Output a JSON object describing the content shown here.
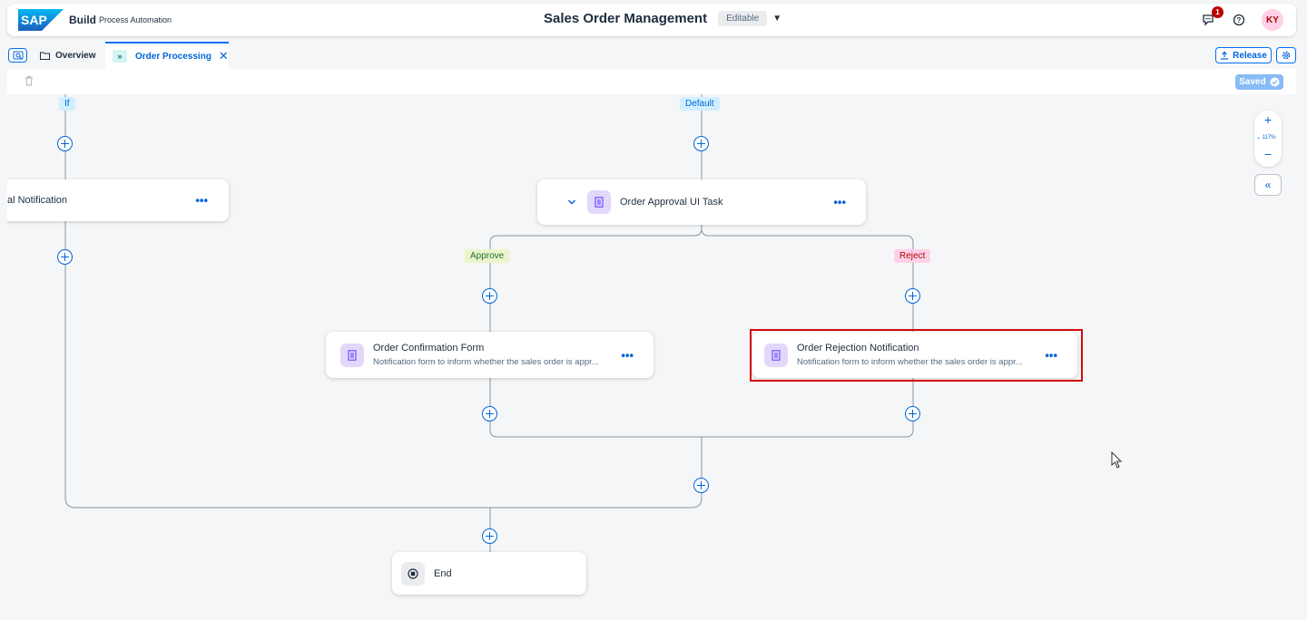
{
  "shell": {
    "brand": "Build",
    "brand_sub": "Process Automation",
    "title": "Sales Order Management",
    "status": "Editable",
    "notification_count": "1",
    "avatar_initials": "KY"
  },
  "tabs": {
    "overview": "Overview",
    "active": "Order Processing",
    "active_icon_text": "»"
  },
  "actions": {
    "release": "Release",
    "saved": "Saved"
  },
  "canvas": {
    "labels": {
      "if": "If",
      "default": "Default",
      "approve": "Approve",
      "reject": "Reject"
    },
    "nodes": {
      "left_partial": {
        "title": "al Notification"
      },
      "approval": {
        "title": "Order Approval UI Task"
      },
      "confirmation": {
        "title": "Order Confirmation Form",
        "desc": "Notification form to inform whether the sales order is appr..."
      },
      "rejection": {
        "title": "Order Rejection Notification",
        "desc": "Notification form to inform whether the sales order is appr..."
      },
      "end": {
        "title": "End"
      }
    },
    "more_glyph": "•••"
  },
  "zoom": {
    "level": "117%",
    "in": "+",
    "out": "−",
    "collapse": "«"
  },
  "colors": {
    "accent": "#0070f2",
    "highlight": "#d20a0a",
    "node_icon_bg": "#e3d7fb"
  }
}
